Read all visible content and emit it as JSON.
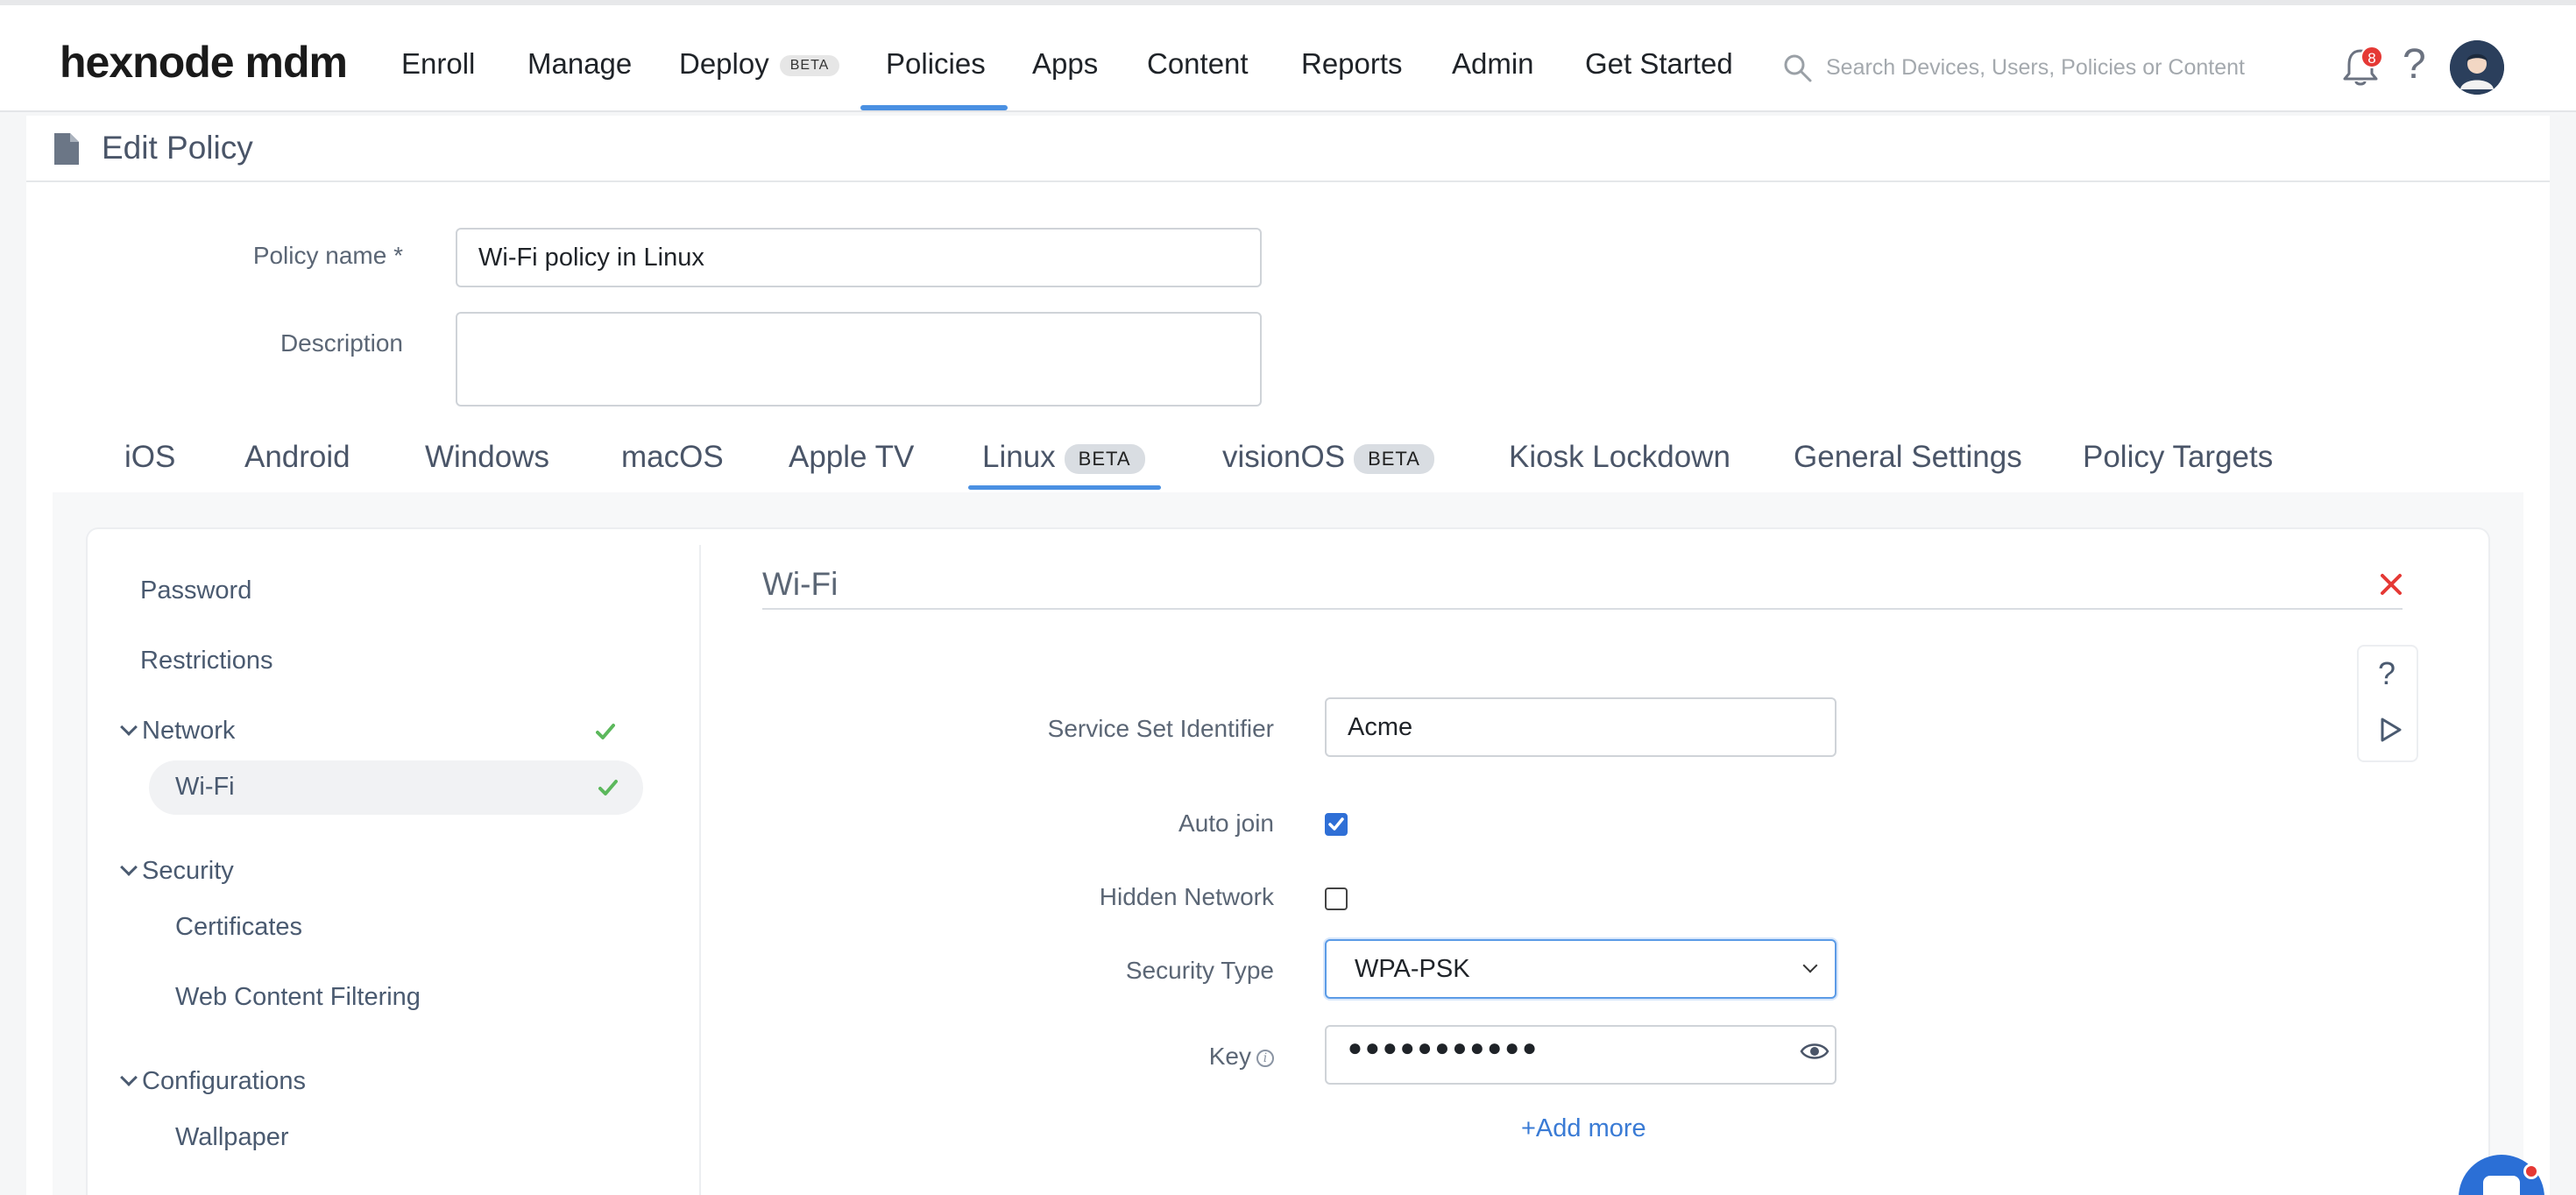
{
  "brand": {
    "name": "hexnode mdm"
  },
  "nav": {
    "items": [
      {
        "label": "Enroll"
      },
      {
        "label": "Manage"
      },
      {
        "label": "Deploy",
        "badge": "BETA"
      },
      {
        "label": "Policies",
        "active": true
      },
      {
        "label": "Apps"
      },
      {
        "label": "Content"
      },
      {
        "label": "Reports"
      },
      {
        "label": "Admin"
      },
      {
        "label": "Get Started"
      }
    ],
    "search_placeholder": "Search Devices, Users, Policies or Content",
    "notification_count": "8",
    "help": "?"
  },
  "page": {
    "title": "Edit Policy"
  },
  "form": {
    "policy_name_label": "Policy name *",
    "policy_name_value": "Wi-Fi policy in Linux",
    "description_label": "Description",
    "description_value": ""
  },
  "tabs": [
    {
      "label": "iOS"
    },
    {
      "label": "Android"
    },
    {
      "label": "Windows"
    },
    {
      "label": "macOS"
    },
    {
      "label": "Apple TV"
    },
    {
      "label": "Linux",
      "badge": "BETA",
      "active": true
    },
    {
      "label": "visionOS",
      "badge": "BETA"
    },
    {
      "label": "Kiosk Lockdown"
    },
    {
      "label": "General Settings"
    },
    {
      "label": "Policy Targets"
    }
  ],
  "sidebar": {
    "items": [
      {
        "label": "Password"
      },
      {
        "label": "Restrictions"
      }
    ],
    "groups": [
      {
        "label": "Network",
        "configured": true,
        "children": [
          {
            "label": "Wi-Fi",
            "active": true,
            "configured": true
          }
        ]
      },
      {
        "label": "Security",
        "children": [
          {
            "label": "Certificates"
          },
          {
            "label": "Web Content Filtering"
          }
        ]
      },
      {
        "label": "Configurations",
        "children": [
          {
            "label": "Wallpaper"
          }
        ]
      }
    ]
  },
  "wifi": {
    "title": "Wi-Fi",
    "ssid_label": "Service Set Identifier",
    "ssid_value": "Acme",
    "auto_join_label": "Auto join",
    "auto_join_checked": true,
    "hidden_network_label": "Hidden Network",
    "hidden_network_checked": false,
    "security_type_label": "Security Type",
    "security_type_value": "WPA-PSK",
    "key_label": "Key",
    "key_masked": "●●●●●●●●●●●",
    "add_more_label": "+Add more",
    "float_help": "?"
  },
  "colors": {
    "accent": "#4a90e2",
    "link": "#3a7bd5",
    "check_green": "#5cb85c",
    "close_red": "#e53935"
  }
}
